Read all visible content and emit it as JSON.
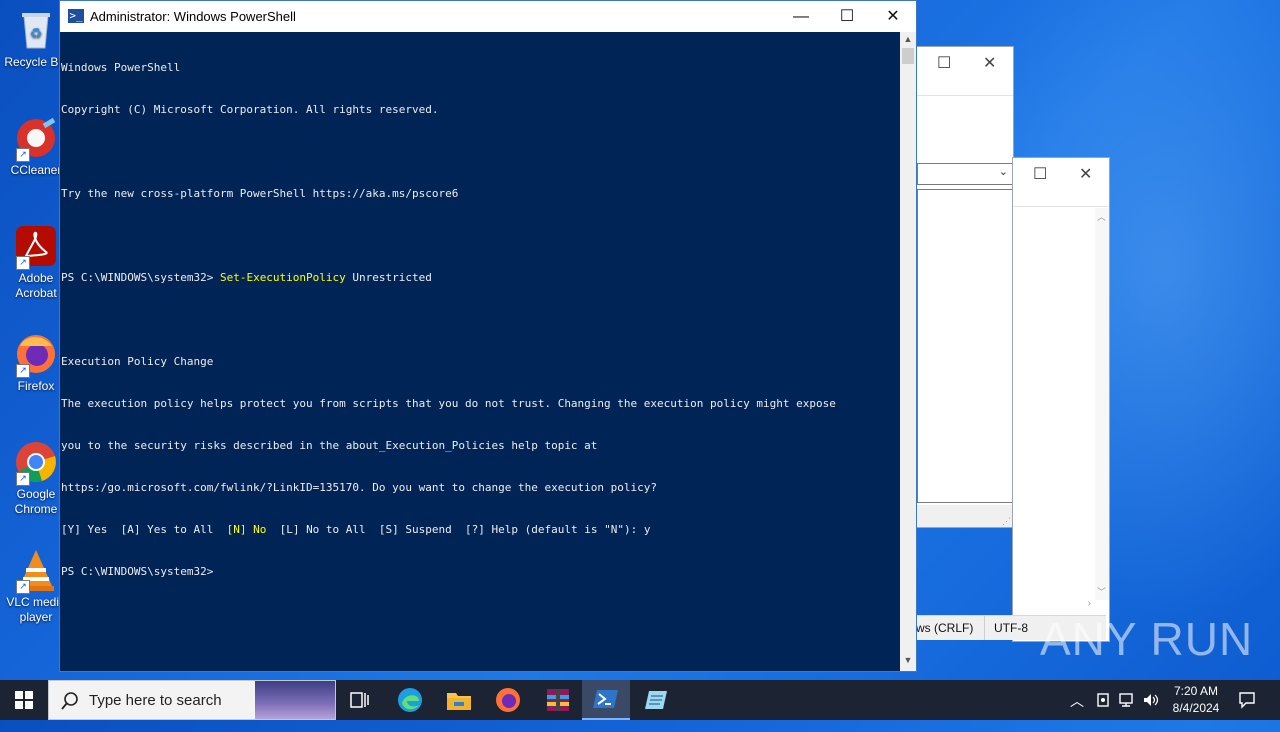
{
  "desktop": {
    "icons": [
      {
        "label": "Recycle Bin",
        "icon": "recycle-bin-icon"
      },
      {
        "label": "CCleaner",
        "icon": "ccleaner-icon"
      },
      {
        "label": "Adobe Acrobat",
        "icon": "acrobat-icon"
      },
      {
        "label": "Firefox",
        "icon": "firefox-icon"
      },
      {
        "label": "Google Chrome",
        "icon": "chrome-icon"
      },
      {
        "label": "VLC media player",
        "icon": "vlc-icon"
      }
    ]
  },
  "background_window": {
    "status_eol": "ws (CRLF)",
    "status_encoding": "UTF-8"
  },
  "powershell": {
    "title": "Administrator: Windows PowerShell",
    "lines": [
      "Windows PowerShell",
      "Copyright (C) Microsoft Corporation. All rights reserved.",
      "",
      "Try the new cross-platform PowerShell https://aka.ms/pscore6",
      "",
      "PS C:\\WINDOWS\\system32> ",
      "",
      "Execution Policy Change",
      "The execution policy helps protect you from scripts that you do not trust. Changing the execution policy might expose",
      "you to the security risks described in the about_Execution_Policies help topic at",
      "https:/go.microsoft.com/fwlink/?LinkID=135170. Do you want to change the execution policy?",
      "[Y] Yes  [A] Yes to All  ",
      "PS C:\\WINDOWS\\system32>"
    ],
    "command_name": "Set-ExecutionPolicy",
    "command_arg": " Unrestricted",
    "prompt_no": "[N] No",
    "prompt_rest": "  [L] No to All  [S] Suspend  [?] Help (default is \"N\"): y"
  },
  "taskbar": {
    "search_placeholder": "Type here to search",
    "time": "7:20 AM",
    "date": "8/4/2024"
  },
  "watermark": "ANY RUN",
  "colors": {
    "console_bg": "#012456",
    "console_fg": "#eeedf0",
    "highlight": "#ffff00",
    "taskbar": "#1c2433"
  }
}
